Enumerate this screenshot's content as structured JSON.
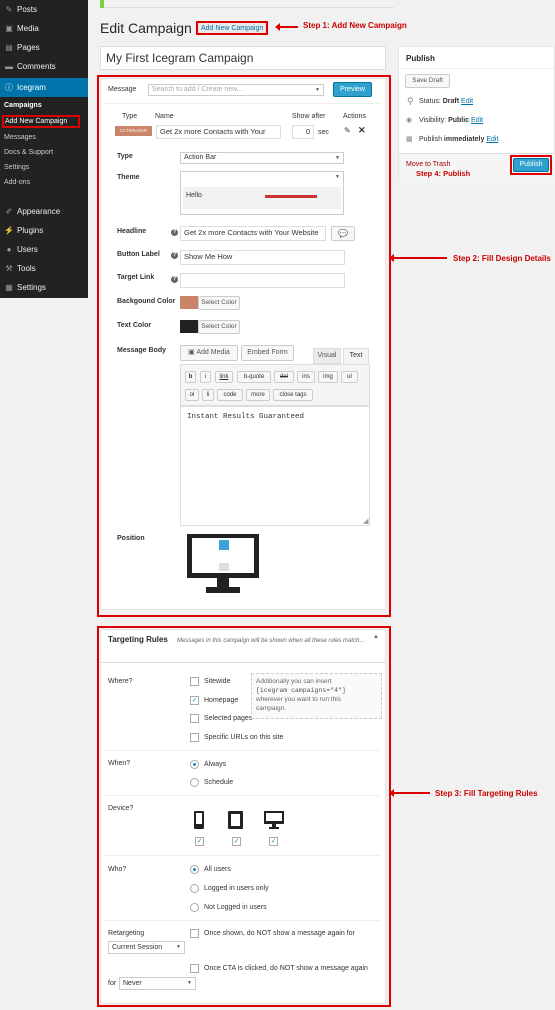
{
  "sidebar": {
    "items": [
      {
        "label": "Posts",
        "icon": "pin-icon"
      },
      {
        "label": "Media",
        "icon": "media-icon"
      },
      {
        "label": "Pages",
        "icon": "pages-icon"
      },
      {
        "label": "Comments",
        "icon": "comments-icon"
      },
      {
        "label": "Icegram",
        "icon": "info-icon"
      }
    ],
    "subs": [
      "Campaigns",
      "Add New Campaign",
      "Messages",
      "Docs & Support",
      "Settings",
      "Add-ons"
    ],
    "items2": [
      {
        "label": "Appearance",
        "icon": "brush-icon"
      },
      {
        "label": "Plugins",
        "icon": "plugin-icon"
      },
      {
        "label": "Users",
        "icon": "users-icon"
      },
      {
        "label": "Tools",
        "icon": "wrench-icon"
      },
      {
        "label": "Settings",
        "icon": "sliders-icon"
      }
    ]
  },
  "header": {
    "title": "Edit Campaign",
    "add_new": "Add New Campaign"
  },
  "campaign_title": "My First Icegram Campaign",
  "message": {
    "label": "Message",
    "search_placeholder": "Search to add / Create new...",
    "preview": "Preview",
    "col_type": "Type",
    "col_name": "Name",
    "col_show_after": "Show after",
    "col_actions": "Actions",
    "type_badge": "ACTION BAR",
    "name_value": "Get 2x more Contacts with Your",
    "show_after_value": "0",
    "sec": "sec",
    "type_label": "Type",
    "type_value": "Action Bar",
    "theme_label": "Theme",
    "theme_value": "Hello",
    "headline_label": "Headline",
    "headline_value": "Get 2x more Contacts with Your Website",
    "button_label_label": "Button Label",
    "button_label_value": "Show Me How",
    "target_link_label": "Target Link",
    "target_link_value": "",
    "bg_color_label": "Backgound Color",
    "text_color_label": "Text Color",
    "select_color": "Select Color",
    "bg_color": "#c98469",
    "text_color": "#222222",
    "body_label": "Message Body",
    "add_media": "Add Media",
    "embed_form": "Embed Form",
    "tab_visual": "Visual",
    "tab_text": "Text",
    "qt_row1": [
      "b",
      "i",
      "link",
      "b-quote",
      "del",
      "ins",
      "img",
      "ul"
    ],
    "qt_row2": [
      "ol",
      "li",
      "code",
      "more",
      "close tags"
    ],
    "body_text": "Instant Results Guaranteed",
    "position_label": "Position"
  },
  "publish": {
    "title": "Publish",
    "save_draft": "Save Draft",
    "status_label": "Status:",
    "status_value": "Draft",
    "visibility_label": "Visibility:",
    "visibility_value": "Public",
    "publish_label": "Publish",
    "publish_value": "immediately",
    "edit": "Edit",
    "trash": "Move to Trash",
    "publish_btn": "Publish"
  },
  "targeting": {
    "title": "Targeting Rules",
    "subtitle": "Messages in this campaign will be shown when all these rules match...",
    "where_label": "Where?",
    "where_opts": [
      {
        "label": "Sitewide",
        "checked": false
      },
      {
        "label": "Homepage",
        "checked": true
      },
      {
        "label": "Selected pages",
        "checked": false
      },
      {
        "label": "Specific URLs on this site",
        "checked": false
      }
    ],
    "note_1": "Additionally you can insert",
    "shortcode": "[icegram campaigns=\"4\"]",
    "note_2": "wherever you want to run this",
    "note_3": "campaign.",
    "when_label": "When?",
    "when_opts": [
      "Always",
      "Schedule"
    ],
    "device_label": "Device?",
    "who_label": "Who?",
    "who_opts": [
      "All users",
      "Logged in users only",
      "Not Logged in users"
    ],
    "retarget_label": "Retargeting",
    "retarget_opt1": "Once shown, do NOT show a message again for",
    "retarget_sel1": "Current Session",
    "retarget_opt2": "Once CTA is clicked, do NOT show a message again",
    "for_label": "for",
    "retarget_sel2": "Never"
  },
  "annotations": {
    "step1": "Step 1: Add New Campaign",
    "step2": "Step 2: Fill Design Details",
    "step3": "Step 3: Fill Targeting Rules",
    "step4": "Step 4:  Publish"
  },
  "colors": {
    "accent": "#0073aa",
    "annotation": "#dd0000",
    "publish": "#2ea2cc"
  }
}
